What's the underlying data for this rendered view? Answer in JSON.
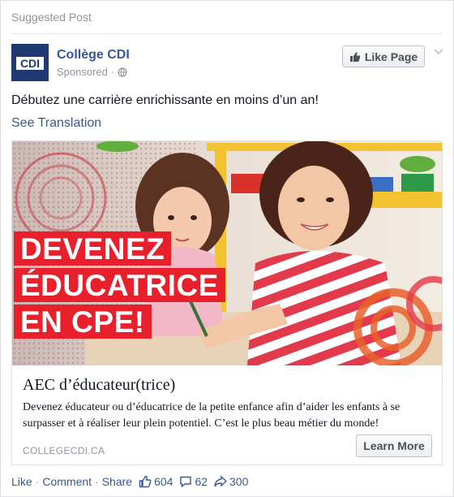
{
  "header": {
    "label": "Suggested Post"
  },
  "page": {
    "logo_text": "CDI",
    "name": "Collège CDI",
    "sponsored": "Sponsored",
    "like_button": "Like Page"
  },
  "post": {
    "text": "Débutez une carrière enrichissante en moins d’un an!",
    "translation_link": "See Translation"
  },
  "image": {
    "banner_lines": [
      "DEVENEZ",
      "ÉDUCATRICE",
      "EN CPE!"
    ]
  },
  "ad": {
    "title": "AEC d’éducateur(trice)",
    "description": "Devenez éducateur ou d’éducatrice de la petite enfance afin d’aider les enfants à se surpasser et à réaliser leur plein potentiel. C’est le plus beau métier du monde!",
    "domain": "COLLEGECDI.CA",
    "cta": "Learn More"
  },
  "footer": {
    "like": "Like",
    "comment": "Comment",
    "share": "Share",
    "like_count": "604",
    "comment_count": "62",
    "share_count": "300"
  },
  "colors": {
    "link": "#365899",
    "banner_red": "#e8202b",
    "logo_blue": "#1f3a73"
  },
  "icons": [
    "globe-icon",
    "thumbs-up-icon",
    "chevron-down-icon",
    "comment-bubble-icon",
    "share-arrow-icon"
  ]
}
